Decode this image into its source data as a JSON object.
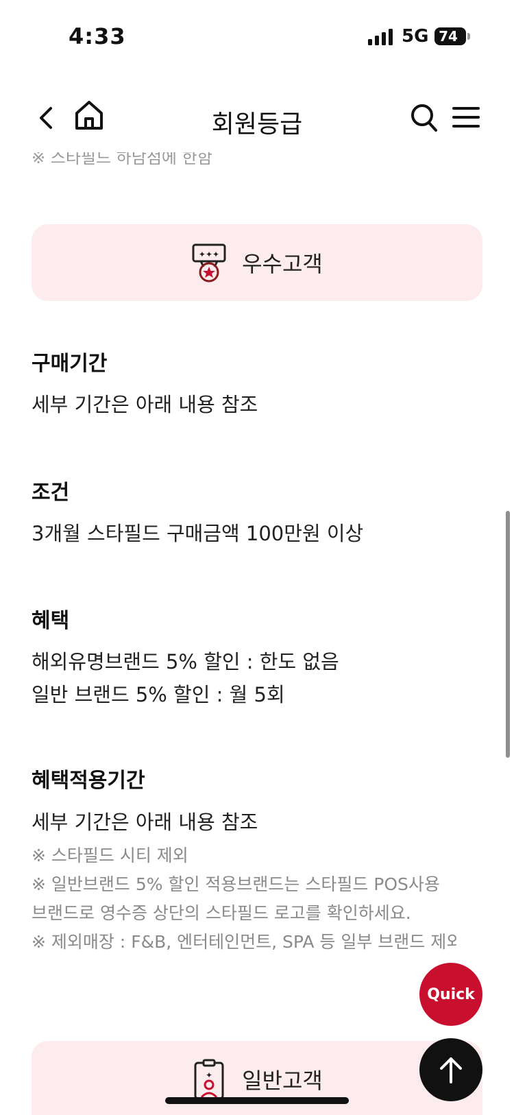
{
  "status": {
    "time": "4:33",
    "network": "5G",
    "battery": "74"
  },
  "nav": {
    "title": "회원등급"
  },
  "clipped_note": "※ 스타필드 하남점에 한함",
  "grade_top": {
    "label": "우수고객"
  },
  "sections": {
    "period": {
      "title": "구매기간",
      "text": "세부 기간은 아래 내용 참조"
    },
    "condition": {
      "title": "조건",
      "text": "3개월 스타필드 구매금액 100만원 이상"
    },
    "benefit": {
      "title": "혜택",
      "line1": "해외유명브랜드 5% 할인 : 한도 없음",
      "line2": "일반 브랜드 5% 할인 : 월 5회"
    },
    "benefit_period": {
      "title": "혜택적용기간",
      "text": "세부 기간은 아래 내용 참조",
      "notes": [
        "※ 스타필드 시티 제외",
        "※ 일반브랜드 5% 할인 적용브랜드는 스타필드 POS사용",
        "브랜드로 영수증 상단의 스타필드 로고를 확인하세요.",
        "※ 제외매장 : F&B, 엔터테인먼트, SPA 등 일부 브랜드 제외"
      ]
    }
  },
  "grade_bottom": {
    "label": "일반고객"
  },
  "quick": {
    "label": "Quick"
  },
  "colors": {
    "accent": "#c8102e",
    "card_bg": "#fcecee",
    "note_text": "#8a8a8a"
  }
}
